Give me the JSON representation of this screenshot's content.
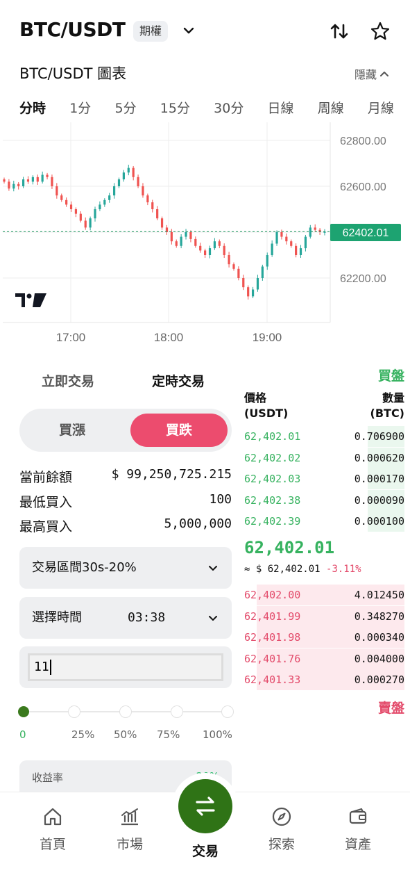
{
  "header": {
    "pair": "BTC/USDT",
    "badge": "期權"
  },
  "chart_section": {
    "title": "BTC/USDT 圖表",
    "hide_label": "隱藏"
  },
  "timeframes": [
    "分時",
    "1分",
    "5分",
    "15分",
    "30分",
    "日線",
    "周線",
    "月線"
  ],
  "active_timeframe": "分時",
  "chart_data": {
    "type": "candlestick",
    "y_ticks": [
      "62800.00",
      "62600.00",
      "62400.00",
      "62200.00"
    ],
    "x_ticks": [
      "17:00",
      "18:00",
      "19:00"
    ],
    "current_price_label": "62402.01",
    "ylim": [
      62100,
      62900
    ],
    "close_series": [
      62620,
      62590,
      62610,
      62600,
      62630,
      62620,
      62640,
      62620,
      62650,
      62640,
      62600,
      62560,
      62540,
      62520,
      62500,
      62480,
      62450,
      62420,
      62460,
      62500,
      62520,
      62540,
      62560,
      62600,
      62630,
      62660,
      62680,
      62640,
      62600,
      62560,
      62530,
      62500,
      62460,
      62420,
      62400,
      62360,
      62340,
      62380,
      62400,
      62370,
      62340,
      62320,
      62300,
      62330,
      62360,
      62340,
      62300,
      62260,
      62240,
      62200,
      62160,
      62120,
      62150,
      62200,
      62250,
      62300,
      62350,
      62400,
      62380,
      62360,
      62340,
      62300,
      62330,
      62380,
      62420,
      62410,
      62400,
      62402
    ],
    "colors": {
      "up": "#26a69a",
      "down": "#ef5350",
      "price_line": "#2e9e6b",
      "price_tag": "#1da371"
    }
  },
  "trade_tabs": {
    "instant": "立即交易",
    "timed": "定時交易"
  },
  "direction": {
    "up": "買漲",
    "down": "買跌"
  },
  "balance": {
    "current_label": "當前餘額",
    "current_value": "$ 99,250,725.215",
    "min_label": "最低買入",
    "min_value": "100",
    "max_label": "最高買入",
    "max_value": "5,000,000"
  },
  "interval_select": "交易區間30s-20%",
  "time_select": {
    "label": "選擇時間",
    "value": "03:38"
  },
  "amount_input": "11",
  "slider_labels": [
    "0",
    "25%",
    "50%",
    "75%",
    "100%"
  ],
  "slider_value": 0,
  "yield": {
    "label": "收益率",
    "value": "20%"
  },
  "orderbook": {
    "buy_title": "買盤",
    "sell_title": "賣盤",
    "price_header": [
      "價格",
      "(USDT)"
    ],
    "qty_header": [
      "數量",
      "(BTC)"
    ],
    "bids": [
      {
        "price": "62,402.01",
        "qty": "0.706900",
        "depth": 0.23
      },
      {
        "price": "62,402.02",
        "qty": "0.000620",
        "depth": 0.23
      },
      {
        "price": "62,402.03",
        "qty": "0.000170",
        "depth": 0.23
      },
      {
        "price": "62,402.38",
        "qty": "0.000090",
        "depth": 0.23
      },
      {
        "price": "62,402.39",
        "qty": "0.000100",
        "depth": 0.23
      }
    ],
    "last_price": "62,402.01",
    "approx_prefix": "≈ $ 62,402.01",
    "change": "-3.11%",
    "asks": [
      {
        "price": "62,402.00",
        "qty": "4.012450",
        "depth": 0.92
      },
      {
        "price": "62,401.99",
        "qty": "0.348270",
        "depth": 0.92
      },
      {
        "price": "62,401.98",
        "qty": "0.000340",
        "depth": 0.92
      },
      {
        "price": "62,401.76",
        "qty": "0.004000",
        "depth": 0.92
      },
      {
        "price": "62,401.33",
        "qty": "0.000270",
        "depth": 0.92
      }
    ]
  },
  "nav": {
    "home": "首頁",
    "market": "市場",
    "trade": "交易",
    "explore": "探索",
    "assets": "資產"
  }
}
